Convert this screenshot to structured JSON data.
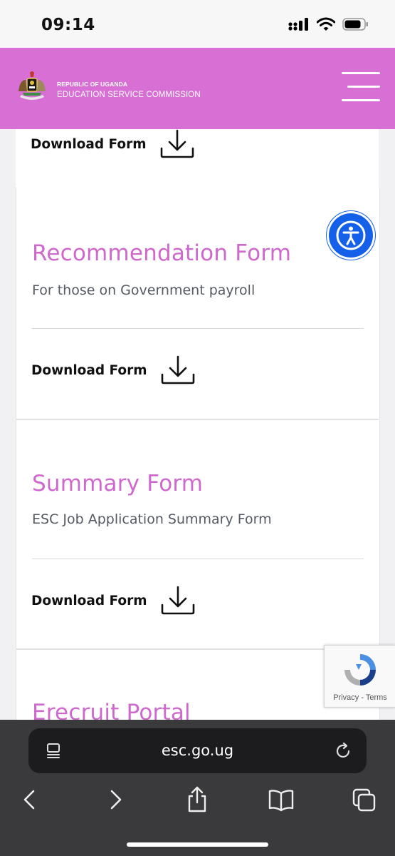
{
  "status": {
    "time": "09:14"
  },
  "header": {
    "line1": "REPUBLIC OF UGANDA",
    "line2": "EDUCATION SERVICE COMMISSION"
  },
  "forms": [
    {
      "title": "",
      "description": "",
      "download_label": "Download Form"
    },
    {
      "title": "Recommendation Form",
      "description": "For those on Government payroll",
      "download_label": "Download Form"
    },
    {
      "title": "Summary Form",
      "description": "ESC Job Application Summary Form",
      "download_label": "Download Form"
    },
    {
      "title": "Erecruit Portal"
    }
  ],
  "recaptcha": {
    "privacy": "Privacy",
    "sep": "-",
    "terms": "Terms"
  },
  "browser": {
    "url": "esc.go.ug"
  },
  "colors": {
    "header": "#d86fd5",
    "title": "#cf68cd",
    "a11y": "#1560e8"
  }
}
